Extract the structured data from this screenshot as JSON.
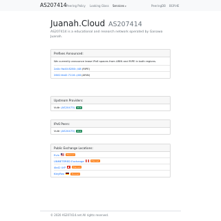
{
  "nav": {
    "brand": "AS207414",
    "links": [
      "Peering Policy",
      "Looking Glass",
      "Services"
    ],
    "right_links": [
      "PeeringDB",
      "BGP.HE"
    ]
  },
  "header": {
    "title": "Juanah.Cloud",
    "asn": "AS207414",
    "description": "AS207414 is a educational and research network operated by Ganawa Juanah."
  },
  "prefixes": {
    "title": "Prefixes Announced:",
    "note": "We currently announce lease IPv6 spaces from ARIN and RIPE in both regions.",
    "items": [
      {
        "prefix": "2a0c:9a40:8280::/48",
        "registry": "(RIPE)"
      },
      {
        "prefix": "2602:fed2:7116::/48",
        "registry": "(ARIN)"
      }
    ]
  },
  "upstream": {
    "title": "Upstream Providers:",
    "items": [
      {
        "name": "Vultr",
        "asn": "(AS20473)",
        "badge": "IPv6"
      }
    ]
  },
  "peers": {
    "title": "IPv6 Peers:",
    "items": [
      {
        "name": "Vultr",
        "asn": "(AS20473)",
        "badge": "IPv6"
      }
    ]
  },
  "ixps": {
    "title": "Public Exchange Locations:",
    "items": [
      {
        "name": "Evix",
        "flag": "us-flag",
        "badge": "Planned"
      },
      {
        "name": "UNMETERED Exchange",
        "flag": "ca-flag",
        "badge": "Planned"
      },
      {
        "name": "4b42 IXP",
        "flag": "ch-flag",
        "badge": "Planned"
      },
      {
        "name": "KleyRex",
        "flag": "de-flag",
        "badge": "Planned"
      }
    ]
  },
  "footer": "© 2020 AS207414.net All rights reserved.",
  "colors": {
    "link": "#0d6efd",
    "badge_green": "#198754",
    "badge_orange": "#fd7e14"
  }
}
